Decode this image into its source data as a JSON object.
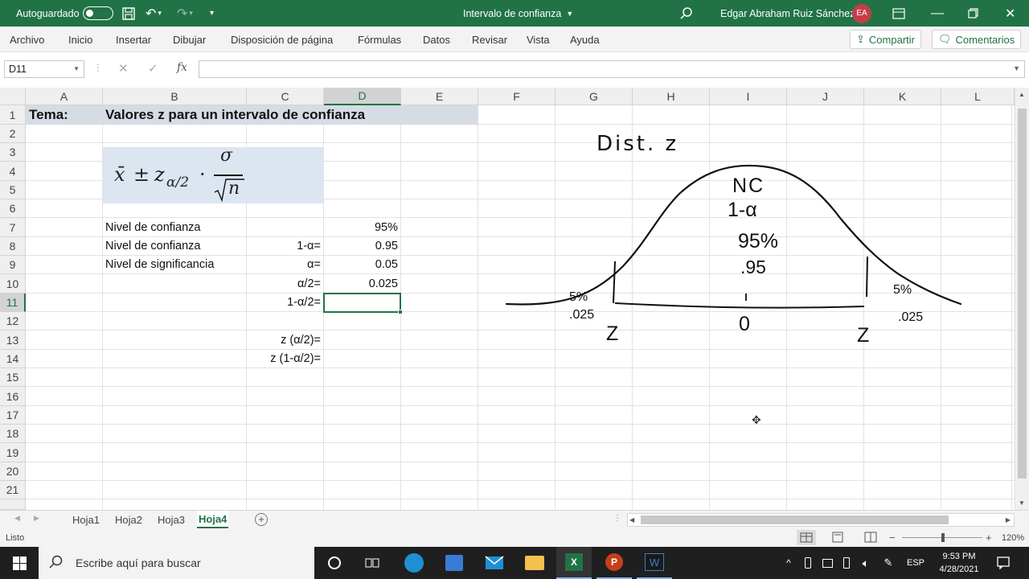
{
  "titlebar": {
    "autosave_label": "Autoguardado",
    "doc_title": "Intervalo de confianza",
    "user_name": "Edgar Abraham Ruiz Sánchez",
    "user_initials": "EA"
  },
  "ribbon": {
    "tabs": [
      "Archivo",
      "Inicio",
      "Insertar",
      "Dibujar",
      "Disposición de página",
      "Fórmulas",
      "Datos",
      "Revisar",
      "Vista",
      "Ayuda"
    ],
    "share_label": "Compartir",
    "comments_label": "Comentarios"
  },
  "formula_bar": {
    "name_box": "D11",
    "fx": "fx",
    "value": ""
  },
  "grid": {
    "columns": [
      "A",
      "B",
      "C",
      "D",
      "E",
      "F",
      "G",
      "H",
      "I",
      "J",
      "K",
      "L"
    ],
    "rows": [
      "1",
      "2",
      "3",
      "4",
      "5",
      "6",
      "7",
      "8",
      "9",
      "10",
      "11",
      "12",
      "13",
      "14",
      "15",
      "16",
      "17",
      "18",
      "19",
      "20",
      "21"
    ],
    "selected_cell": "D11"
  },
  "cells": {
    "a1": "Tema:",
    "b1": "Valores z para un intervalo de confianza",
    "b7": "Nivel de confianza",
    "b8": "Nivel de confianza",
    "b9": "Nivel de significancia",
    "d7": "95%",
    "c8": "1-α=",
    "d8": "0.95",
    "c9": "α=",
    "d9": "0.05",
    "c10": "α/2=",
    "d10": "0.025",
    "c11": "1-α/2=",
    "c13": "z (α/2)=",
    "c14": "z (1-α/2)="
  },
  "formula_image": {
    "xbar": "x̄",
    "pm": "±",
    "z": "z",
    "sub": "α/2",
    "dot": "·",
    "sigma": "σ",
    "n": "n"
  },
  "ink": {
    "title": "Dist. z",
    "nc": "NC",
    "one_minus_alpha": "1-α",
    "pct": "95%",
    "dec": ".95",
    "left_pct": "5%",
    "left_dec": ".025",
    "right_pct": "5%",
    "right_dec": ".025",
    "z_left": "Z",
    "zero": "0",
    "z_right": "Z"
  },
  "sheets": [
    "Hoja1",
    "Hoja2",
    "Hoja3",
    "Hoja4"
  ],
  "active_sheet": "Hoja4",
  "status": {
    "ready": "Listo",
    "zoom": "120%"
  },
  "taskbar": {
    "search_placeholder": "Escribe aquí para buscar",
    "lang": "ESP",
    "time": "9:53 PM",
    "date": "4/28/2021"
  },
  "colors": {
    "excel_green": "#217346",
    "formula_fill": "#dce6f1",
    "title_fill": "#d6dce4"
  }
}
